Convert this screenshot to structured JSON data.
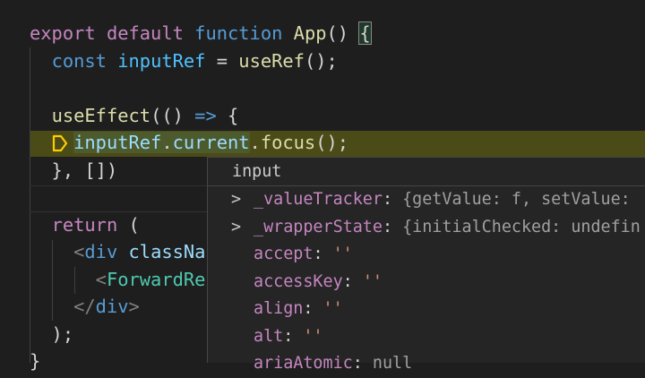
{
  "editor": {
    "lines": [
      [
        {
          "t": "export",
          "c": "kw"
        },
        {
          "t": " "
        },
        {
          "t": "default",
          "c": "kw"
        },
        {
          "t": " "
        },
        {
          "t": "function",
          "c": "st"
        },
        {
          "t": " "
        },
        {
          "t": "App",
          "c": "fn"
        },
        {
          "t": "() "
        },
        {
          "t": "{",
          "c": "brace"
        }
      ],
      [
        {
          "t": "  "
        },
        {
          "t": "const",
          "c": "st"
        },
        {
          "t": " "
        },
        {
          "t": "inputRef",
          "c": "cst"
        },
        {
          "t": " = "
        },
        {
          "t": "useRef",
          "c": "fn"
        },
        {
          "t": "();"
        }
      ],
      [],
      [
        {
          "t": "  "
        },
        {
          "t": "useEffect",
          "c": "fn"
        },
        {
          "t": "(() "
        },
        {
          "t": "=>",
          "c": "st"
        },
        {
          "t": " {"
        }
      ],
      [
        {
          "t": "    "
        },
        {
          "t": "inputRef",
          "c": "var sel"
        },
        {
          "t": ".",
          "c": "sel"
        },
        {
          "t": "current",
          "c": "var sel"
        },
        {
          "t": "."
        },
        {
          "t": "focus",
          "c": "fn"
        },
        {
          "t": "();"
        }
      ],
      [
        {
          "t": "  }, [])"
        }
      ],
      [],
      [
        {
          "t": "  "
        },
        {
          "t": "return",
          "c": "kw"
        },
        {
          "t": " ("
        }
      ],
      [
        {
          "t": "    "
        },
        {
          "t": "<",
          "c": "tag"
        },
        {
          "t": "div",
          "c": "tn"
        },
        {
          "t": " "
        },
        {
          "t": "classNa",
          "c": "var"
        }
      ],
      [
        {
          "t": "      "
        },
        {
          "t": "<",
          "c": "tag"
        },
        {
          "t": "ForwardRe",
          "c": "cmp"
        }
      ],
      [
        {
          "t": "    "
        },
        {
          "t": "</",
          "c": "tag"
        },
        {
          "t": "div",
          "c": "tn"
        },
        {
          "t": ">",
          "c": "tag"
        }
      ],
      [
        {
          "t": "  );"
        }
      ],
      [
        {
          "t": "}"
        }
      ]
    ]
  },
  "hover": {
    "title": "input",
    "rows": [
      {
        "expandable": true,
        "key": "_valueTracker",
        "value": "{getValue: f, setValue: ",
        "vc": "pv"
      },
      {
        "expandable": true,
        "key": "_wrapperState",
        "value": "{initialChecked: undefin",
        "vc": "pv"
      },
      {
        "expandable": false,
        "key": "accept",
        "value": "''",
        "vc": "ps"
      },
      {
        "expandable": false,
        "key": "accessKey",
        "value": "''",
        "vc": "ps"
      },
      {
        "expandable": false,
        "key": "align",
        "value": "''",
        "vc": "ps"
      },
      {
        "expandable": false,
        "key": "alt",
        "value": "''",
        "vc": "ps"
      },
      {
        "expandable": false,
        "key": "ariaAtomic",
        "value": "null",
        "vc": "pv"
      }
    ]
  },
  "colors": {
    "current_line": "#4b4b18",
    "breakpoint": "#ffcc00"
  }
}
